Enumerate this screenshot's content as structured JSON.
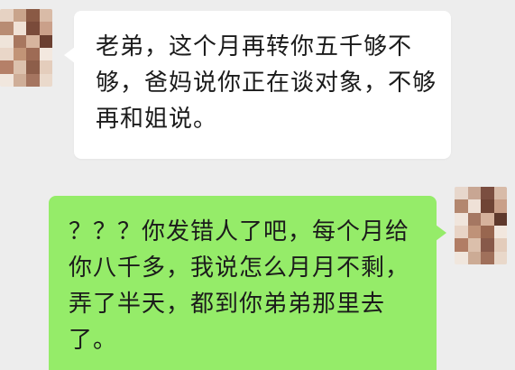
{
  "chat": {
    "messages": [
      {
        "sender": "left",
        "text": "老弟，这个月再转你五千够不够，爸妈说你正在谈对象，不够再和姐说。",
        "bubble_color": "#ffffff"
      },
      {
        "sender": "right",
        "text": "？？？你发错人了吧，每个月给你八千多，我说怎么月月不剩，弄了半天，都到你弟弟那里去了。",
        "bubble_color": "#95ec69"
      }
    ]
  },
  "colors": {
    "background": "#ededed",
    "incoming_bubble": "#ffffff",
    "outgoing_bubble": "#95ec69"
  },
  "avatars": {
    "left": "pixelated-avatar",
    "right": "pixelated-avatar"
  }
}
